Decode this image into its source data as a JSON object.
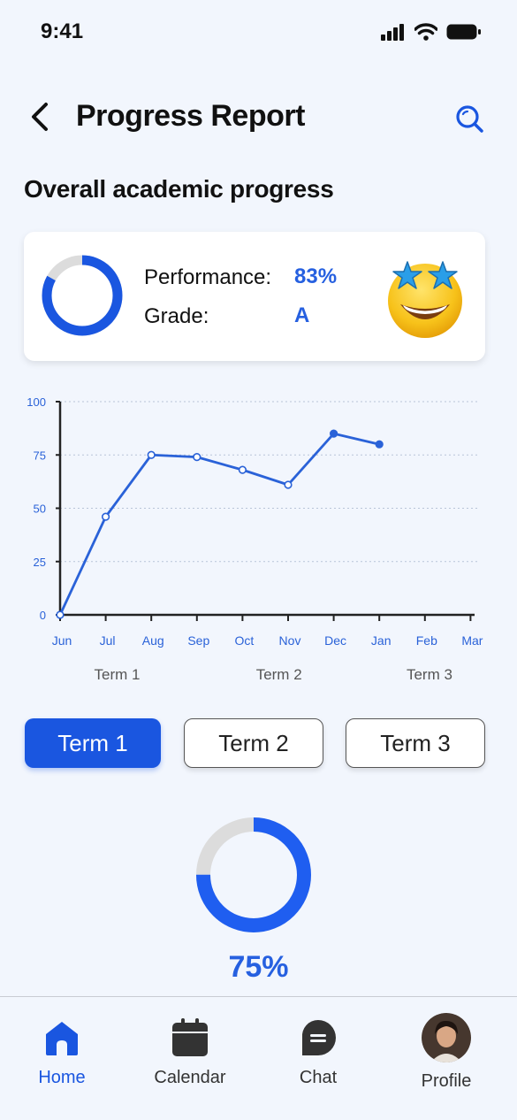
{
  "status_bar": {
    "time": "9:41"
  },
  "header": {
    "title": "Progress Report",
    "back_icon": "chevron-left-icon",
    "search_icon": "search-icon"
  },
  "section_title": "Overall academic progress",
  "summary": {
    "performance_label": "Performance:",
    "performance_value": "83%",
    "performance_fraction": 0.83,
    "grade_label": "Grade:",
    "grade_value": "A",
    "emoji": "star-struck-emoji-icon"
  },
  "chart_data": {
    "type": "line",
    "categories": [
      "Jun",
      "Jul",
      "Aug",
      "Sep",
      "Oct",
      "Nov",
      "Dec",
      "Jan",
      "Feb",
      "Mar"
    ],
    "series": [
      {
        "values": [
          0,
          46,
          75,
          74,
          68,
          61,
          85,
          80
        ]
      }
    ],
    "yticks": [
      "0",
      "25",
      "50",
      "75",
      "100"
    ],
    "ylim": [
      0,
      100
    ],
    "grid": "horizontal dotted",
    "terms": [
      "Term 1",
      "Term 2",
      "Term 3"
    ]
  },
  "term_tabs": [
    {
      "label": "Term 1",
      "active": true
    },
    {
      "label": "Term 2",
      "active": false
    },
    {
      "label": "Term 3",
      "active": false
    }
  ],
  "term_progress": {
    "value": "75%",
    "fraction": 0.75
  },
  "nav": [
    {
      "label": "Home",
      "icon": "home-icon",
      "active": true
    },
    {
      "label": "Calendar",
      "icon": "calendar-icon",
      "active": false
    },
    {
      "label": "Chat",
      "icon": "chat-icon",
      "active": false
    },
    {
      "label": "Profile",
      "icon": "avatar",
      "active": false
    }
  ],
  "colors": {
    "accent": "#1a56e0",
    "line": "#2a62d8",
    "ring_track": "#dcdcdc",
    "background": "#f2f6fd"
  }
}
